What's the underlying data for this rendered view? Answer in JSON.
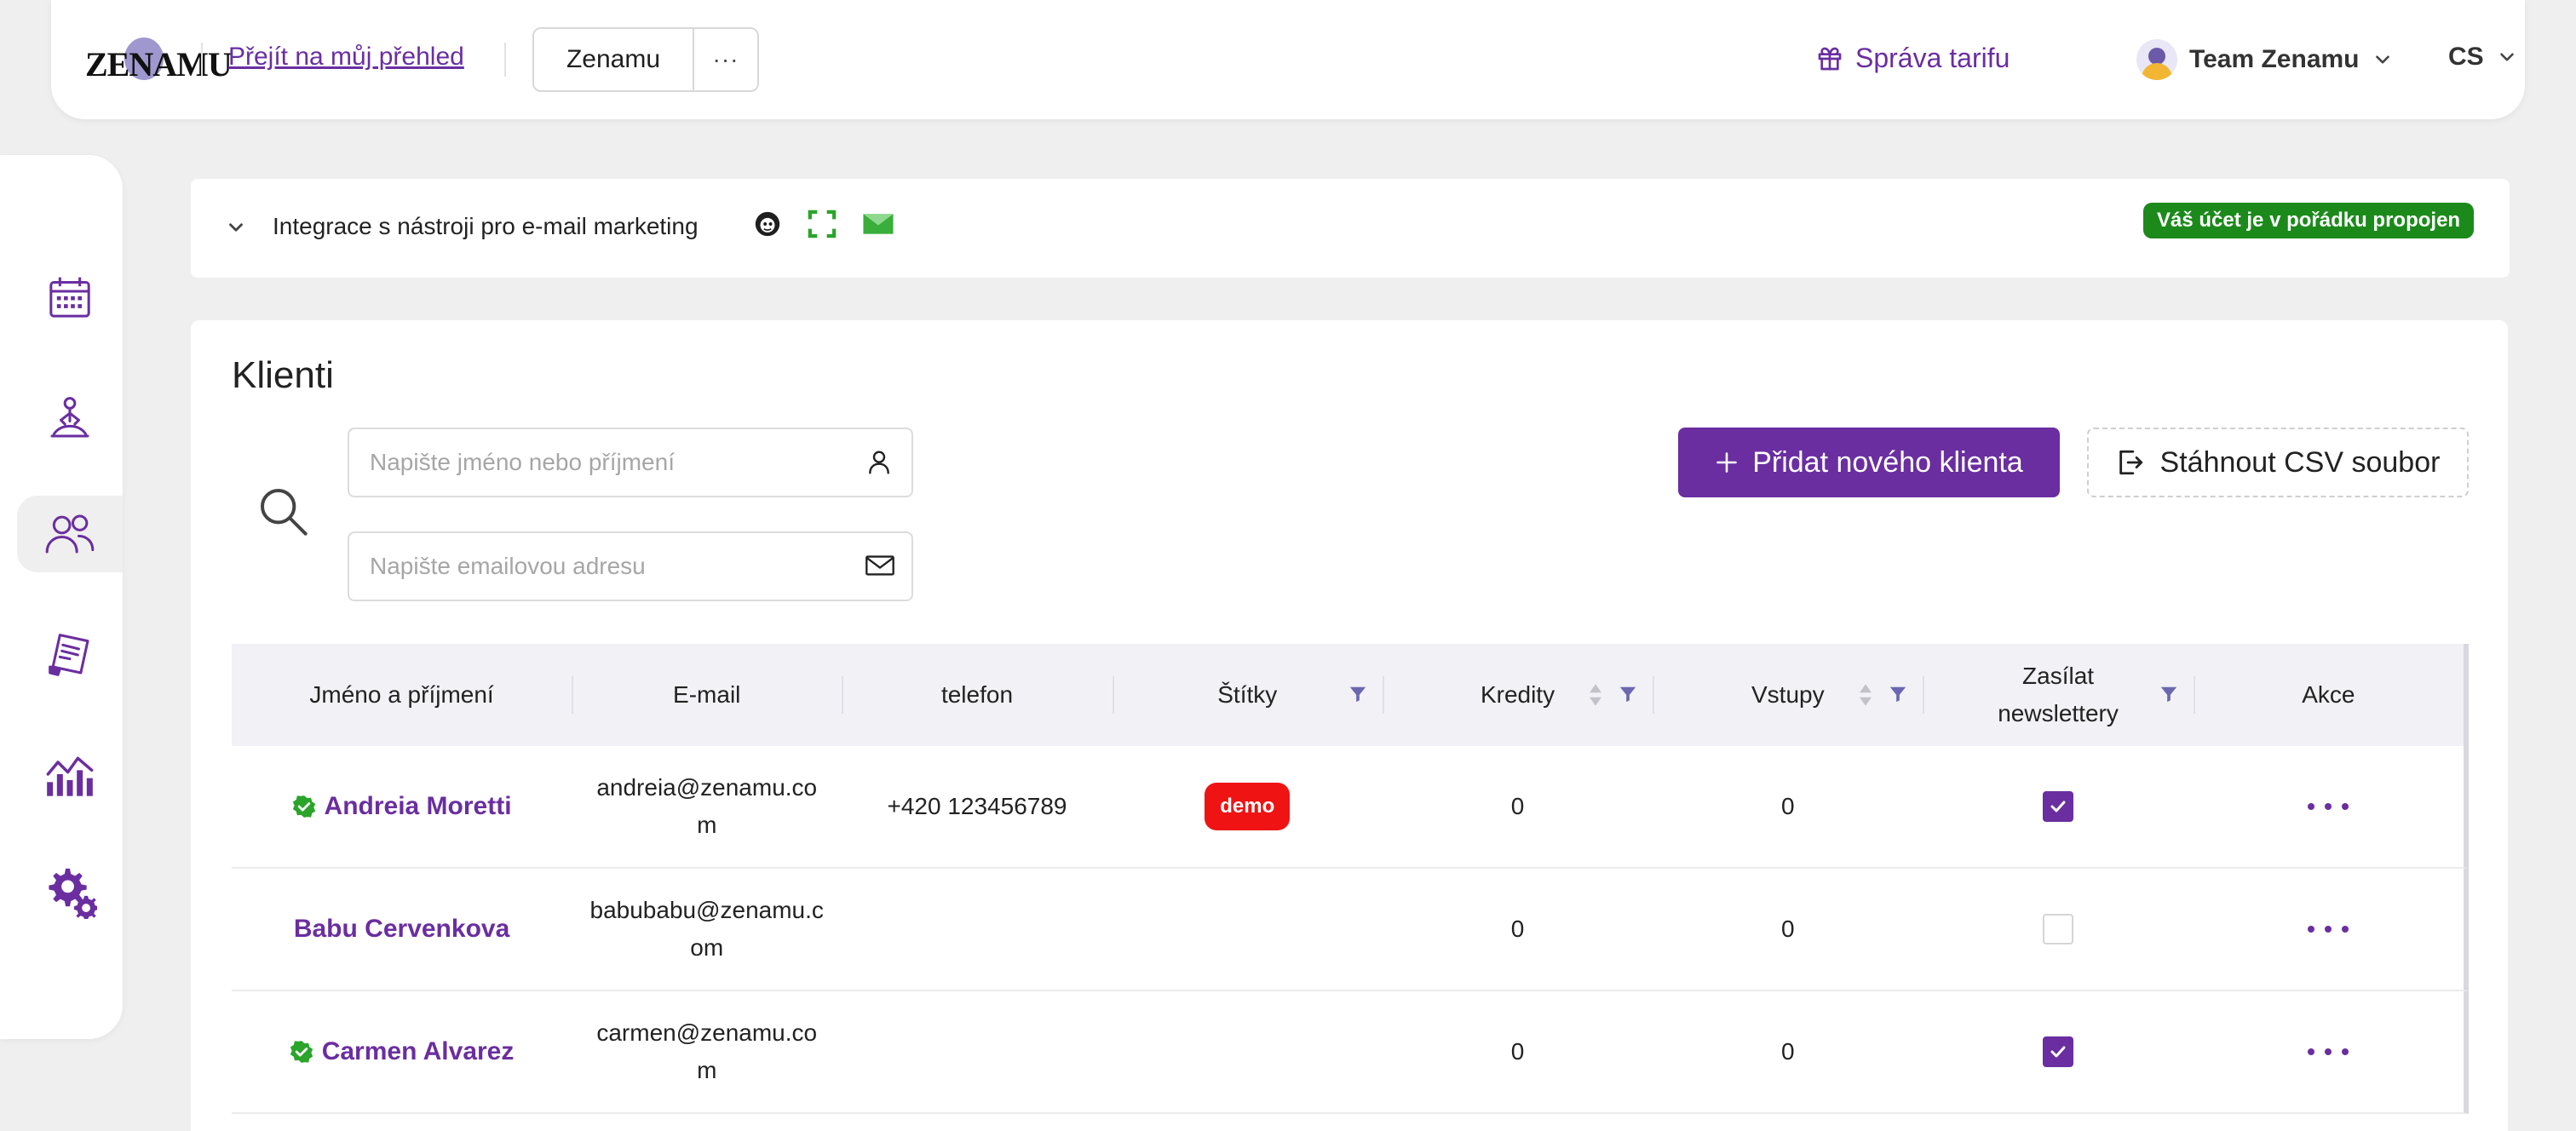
{
  "header": {
    "logo_text": "ZENAMU",
    "overview_link": "Přejít na můj přehled",
    "studio_name": "Zenamu",
    "studio_more": "···",
    "plan_label": "Správa tarifu",
    "team_name": "Team Zenamu",
    "language": "CS"
  },
  "sidebar": {
    "items": [
      {
        "name": "calendar",
        "active": false
      },
      {
        "name": "lessons",
        "active": false
      },
      {
        "name": "clients",
        "active": true
      },
      {
        "name": "orders",
        "active": false
      },
      {
        "name": "statistics",
        "active": false
      },
      {
        "name": "settings",
        "active": false
      }
    ]
  },
  "integration": {
    "label": "Integrace s nástroji pro e-mail marketing",
    "status": "Váš účet je v pořádku propojen"
  },
  "clients": {
    "title": "Klienti",
    "search_name_placeholder": "Napište jméno nebo příjmení",
    "search_email_placeholder": "Napište emailovou adresu",
    "add_button": "Přidat nového klienta",
    "csv_button": "Stáhnout CSV soubor",
    "columns": [
      "Jméno a příjmení",
      "E-mail",
      "telefon",
      "Štítky",
      "Kredity",
      "Vstupy",
      "Zasílat newslettery",
      "Akce"
    ],
    "rows": [
      {
        "name": "Andreia Moretti",
        "verified": true,
        "email_l1": "andreia@zenamu.co",
        "email_l2": "m",
        "phone": "+420 123456789",
        "tag": "demo",
        "credits": "0",
        "entries": "0",
        "newsletter": true
      },
      {
        "name": "Babu Cervenkova",
        "verified": false,
        "email_l1": "babubabu@zenamu.c",
        "email_l2": "om",
        "phone": "",
        "tag": "",
        "credits": "0",
        "entries": "0",
        "newsletter": false
      },
      {
        "name": "Carmen Alvarez",
        "verified": true,
        "email_l1": "carmen@zenamu.co",
        "email_l2": "m",
        "phone": "",
        "tag": "",
        "credits": "0",
        "entries": "0",
        "newsletter": true
      }
    ]
  },
  "colors": {
    "accent": "#6a2ea0",
    "success": "#1b8a1b",
    "tag_red": "#ef1313",
    "background": "#efefef"
  }
}
